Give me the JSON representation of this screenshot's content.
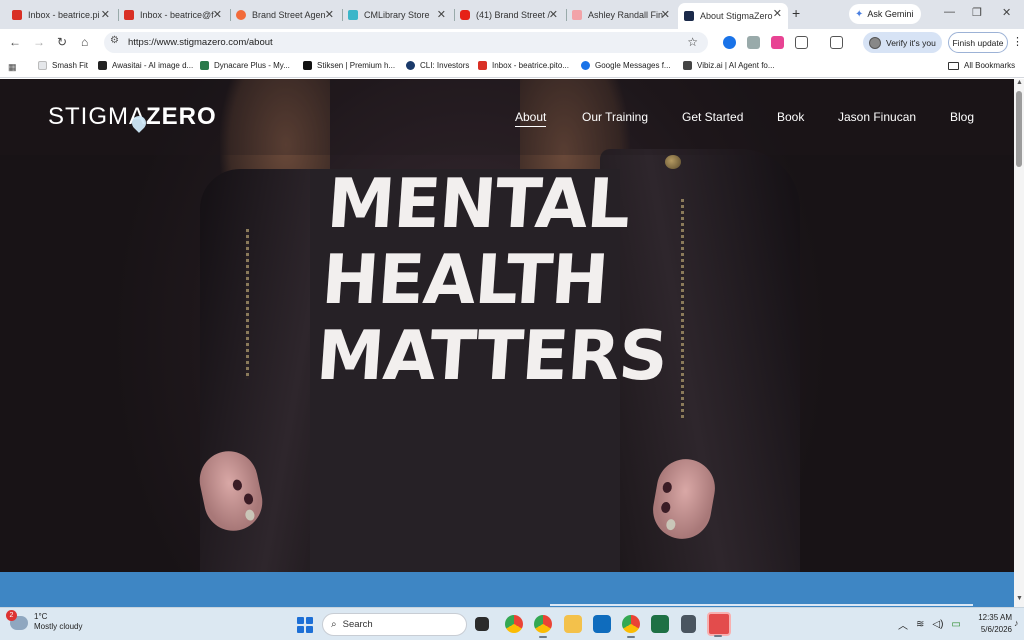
{
  "browser": {
    "tabs": [
      {
        "title": "Inbox - beatrice.pi",
        "color": "#d93025"
      },
      {
        "title": "Inbox - beatrice@f",
        "color": "#d93025"
      },
      {
        "title": "Brand Street Agen",
        "color": "#f26b3a"
      },
      {
        "title": "CMLibrary Store",
        "color": "#3bb6c9"
      },
      {
        "title": "(41) Brand Street /",
        "color": "#e62117"
      },
      {
        "title": "Ashley Randall Fin",
        "color": "#f2a3a8"
      },
      {
        "title": "About StigmaZero",
        "color": "#1b2a4a"
      }
    ],
    "ask_gemini": "Ask Gemini",
    "url": "https://www.stigmazero.com/about",
    "verify": "Verify it's you",
    "finish_update": "Finish update"
  },
  "bookmarks": {
    "items": [
      {
        "label": "Smash Fit",
        "color": "#e5e7ea"
      },
      {
        "label": "Awasitai - AI image d...",
        "color": "#222"
      },
      {
        "label": "Dynacare Plus - My...",
        "color": "#2a7a4a"
      },
      {
        "label": "Stiksen | Premium h...",
        "color": "#111"
      },
      {
        "label": "CLI: Investors",
        "color": "#1a3a6a"
      },
      {
        "label": "Inbox - beatrice.pito...",
        "color": "#d93025"
      },
      {
        "label": "Google Messages f...",
        "color": "#1a73e8"
      },
      {
        "label": "Vibiz.ai | AI Agent fo...",
        "color": "#444"
      }
    ],
    "all": "All Bookmarks"
  },
  "site": {
    "logo_a": "STIGMA",
    "logo_b": "ZERO",
    "nav": [
      "About",
      "Our Training",
      "Get Started",
      "Book",
      "Jason Finucan",
      "Blog"
    ],
    "slogan": [
      "MENTAL",
      "HEALTH",
      "MATTERS"
    ]
  },
  "taskbar": {
    "temp": "1°C",
    "weather": "Mostly cloudy",
    "badge": "2",
    "search": "Search",
    "time": "12:35 AM",
    "date": "5/6/2026"
  }
}
